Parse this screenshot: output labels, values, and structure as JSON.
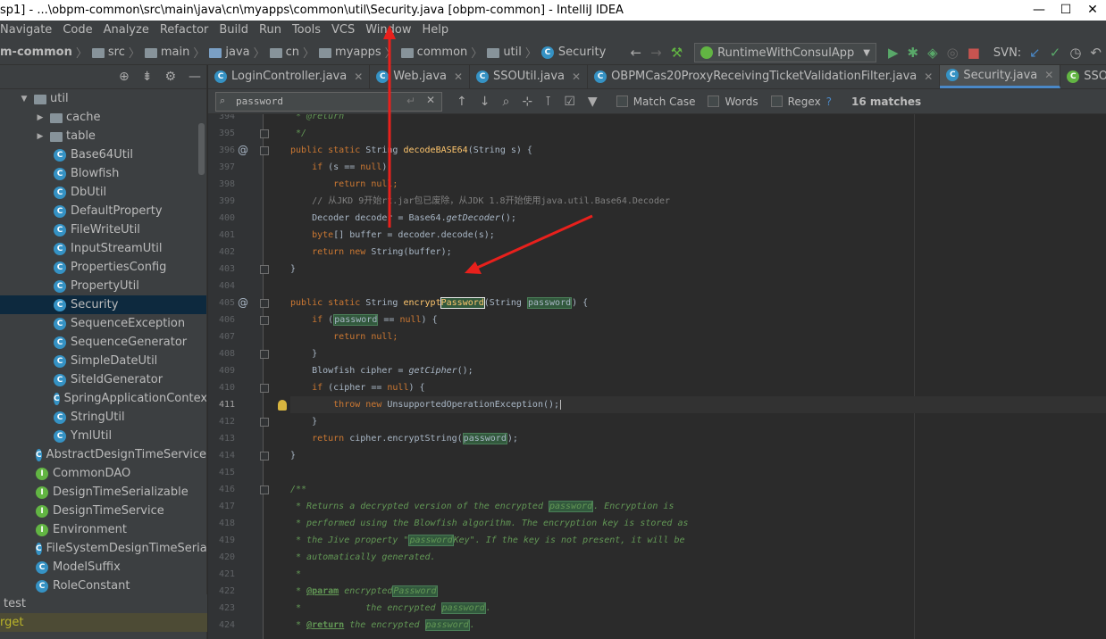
{
  "window": {
    "title": "sp1] - ...\\obpm-common\\src\\main\\java\\cn\\myapps\\common\\util\\Security.java [obpm-common] - IntelliJ IDEA",
    "controls": [
      "—",
      "☐",
      "✕"
    ]
  },
  "menu": [
    "Navigate",
    "Code",
    "Analyze",
    "Refactor",
    "Build",
    "Run",
    "Tools",
    "VCS",
    "Window",
    "Help"
  ],
  "breadcrumb": [
    "m-common",
    "src",
    "main",
    "java",
    "cn",
    "myapps",
    "common",
    "util",
    "Security"
  ],
  "run_config": "RuntimeWithConsulApp",
  "svn_label": "SVN:",
  "tabs": [
    {
      "label": "LoginController.java"
    },
    {
      "label": "Web.java"
    },
    {
      "label": "SSOUtil.java"
    },
    {
      "label": "OBPMCas20ProxyReceivingTicketValidationFilter.java"
    },
    {
      "label": "Security.java"
    },
    {
      "label": "SSO.java"
    }
  ],
  "find": {
    "value": "password",
    "match_case": "Match Case",
    "words": "Words",
    "regex": "Regex",
    "help": "?",
    "matches": "16 matches"
  },
  "tree": {
    "root_folder": "util",
    "subfolders": [
      "cache",
      "table"
    ],
    "util_classes": [
      "Base64Util",
      "Blowfish",
      "DbUtil",
      "DefaultProperty",
      "FileWriteUtil",
      "InputStreamUtil",
      "PropertiesConfig",
      "PropertyUtil",
      "Security",
      "SequenceException",
      "SequenceGenerator",
      "SimpleDateUtil",
      "SiteIdGenerator",
      "SpringApplicationContextU",
      "StringUtil",
      "YmlUtil"
    ],
    "common_items": [
      {
        "icon": "C",
        "label": "AbstractDesignTimeService"
      },
      {
        "icon": "I",
        "label": "CommonDAO"
      },
      {
        "icon": "I",
        "label": "DesignTimeSerializable"
      },
      {
        "icon": "I",
        "label": "DesignTimeService"
      },
      {
        "icon": "I",
        "label": "Environment"
      },
      {
        "icon": "C",
        "label": "FileSystemDesignTimeSerializa"
      },
      {
        "icon": "C",
        "label": "ModelSuffix"
      },
      {
        "icon": "C",
        "label": "RoleConstant"
      }
    ],
    "bottom": [
      "test",
      "rget"
    ]
  },
  "code": {
    "line_numbers": [
      "394",
      "395",
      "396",
      "397",
      "398",
      "399",
      "400",
      "401",
      "402",
      "403",
      "404",
      "405",
      "406",
      "407",
      "408",
      "409",
      "410",
      "411",
      "412",
      "413",
      "414",
      "415",
      "416",
      "417",
      "418",
      "419",
      "420",
      "421",
      "422",
      "423",
      "424"
    ],
    "current_line": "411",
    "lines": {
      "l394": " * @return",
      "l395": " */",
      "l396a": "public static ",
      "l396b": "String ",
      "l396c": "decodeBASE64",
      "l396d": "(String s) {",
      "l397a": "    if ",
      "l397b": "(s == ",
      "l397c": "null",
      "l397d": ")",
      "l398a": "        return ",
      "l398b": "null",
      "l398c": ";",
      "l399": "    // 从JKD 9开始rt.jar包已废除，从JDK 1.8开始使用java.util.Base64.Decoder",
      "l400a": "    Decoder decoder = Base64.",
      "l400b": "getDecoder",
      "l400c": "();",
      "l401a": "    ",
      "l401b": "byte",
      "l401c": "[] buffer = decoder.decode(s);",
      "l402a": "    return new ",
      "l402b": "String(buffer);",
      "l403": "}",
      "l405a": "public static ",
      "l405b": "String ",
      "l405c": "encrypt",
      "l405d": "Password",
      "l405e": "(String ",
      "l405f": "password",
      "l405g": ") {",
      "l406a": "    if ",
      "l406b": "(",
      "l406c": "password",
      "l406d": " == ",
      "l406e": "null",
      "l406f": ") {",
      "l407a": "        return ",
      "l407b": "null",
      "l407c": ";",
      "l408": "    }",
      "l409a": "    Blowfish cipher = ",
      "l409b": "getCipher",
      "l409c": "();",
      "l410a": "    if ",
      "l410b": "(cipher == ",
      "l410c": "null",
      "l410d": ") {",
      "l411a": "        throw new ",
      "l411b": "UnsupportedOperationException();",
      "l412": "    }",
      "l413a": "    return ",
      "l413b": "cipher.encryptString(",
      "l413c": "password",
      "l413d": ");",
      "l414": "}",
      "l416": "/**",
      "l417a": " * Returns a decrypted version of the encrypted ",
      "l417b": "password",
      "l417c": ". Encryption is",
      "l418": " * performed using the Blowfish algorithm. The encryption key is stored as",
      "l419a": " * the Jive property \"",
      "l419b": "password",
      "l419c": "Key\". If the key is not present, it will be",
      "l420": " * automatically generated.",
      "l421": " *",
      "l422a": " * ",
      "l422b": "@param",
      "l422c": " encrypted",
      "l422d": "Password",
      "l423a": " *            the encrypted ",
      "l423b": "password",
      "l423c": ".",
      "l424a": " * ",
      "l424b": "@return",
      "l424c": " the encrypted ",
      "l424d": "password",
      "l424e": "."
    }
  },
  "colors": {
    "accent": "#4a88c7",
    "annotation_arrow": "#e8201c",
    "selection": "#0d293e"
  }
}
